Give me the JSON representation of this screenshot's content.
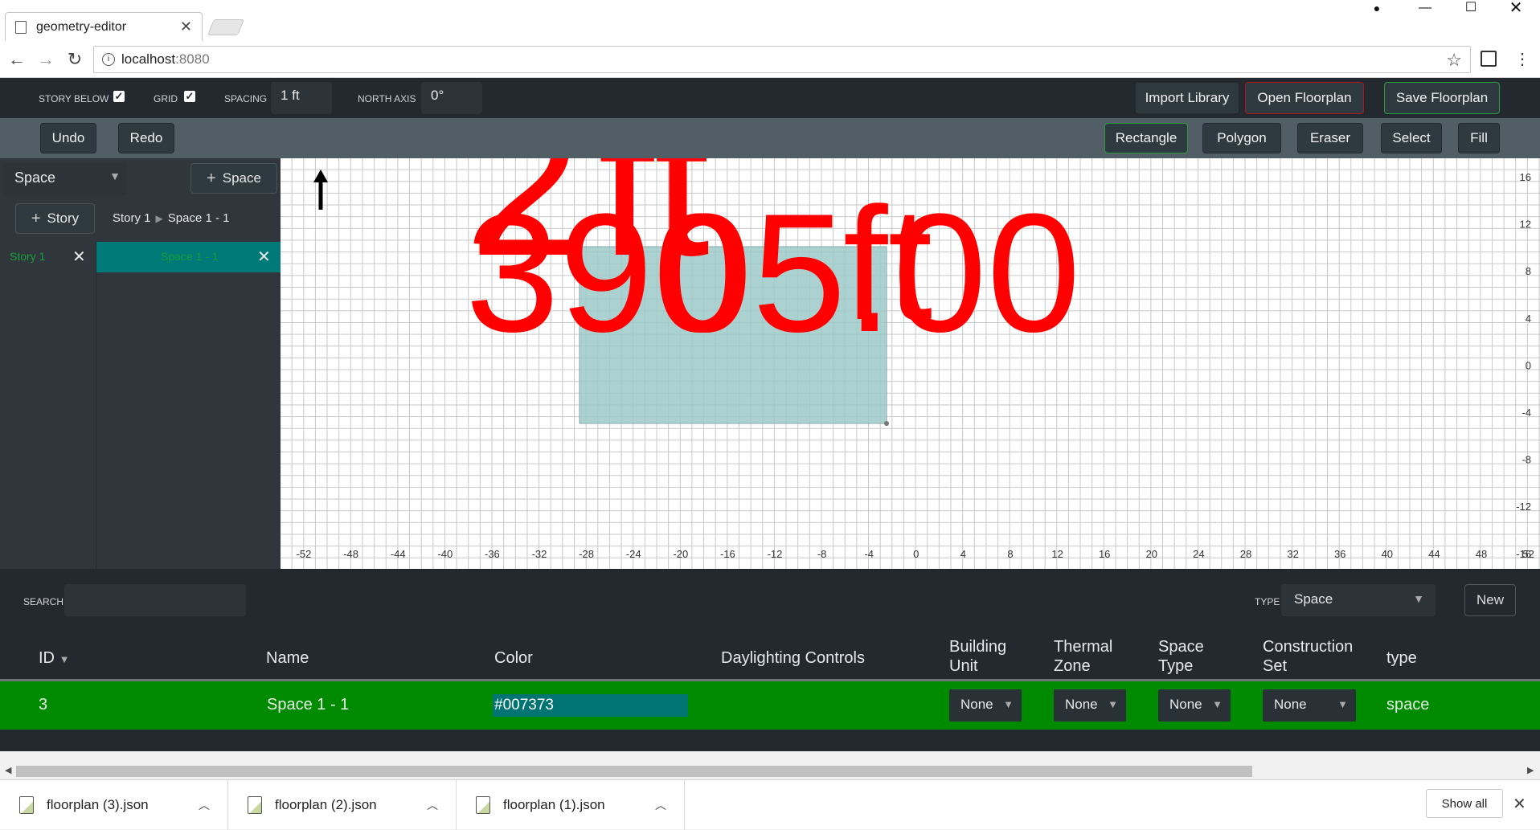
{
  "browser": {
    "tab_title": "geometry-editor",
    "url_host": "localhost",
    "url_port": ":8080"
  },
  "toolbar": {
    "story_below_label": "STORY BELOW",
    "story_below_checked": true,
    "grid_label": "GRID",
    "grid_checked": true,
    "spacing_label": "SPACING",
    "spacing_value": "1 ft",
    "north_axis_label": "NORTH AXIS",
    "north_axis_value": "0°",
    "import_library": "Import Library",
    "open_floorplan": "Open Floorplan",
    "save_floorplan": "Save Floorplan"
  },
  "tools": {
    "undo": "Undo",
    "redo": "Redo",
    "rectangle": "Rectangle",
    "polygon": "Polygon",
    "eraser": "Eraser",
    "select": "Select",
    "fill": "Fill",
    "active_tool": "Rectangle"
  },
  "left_panel": {
    "mode_select": "Space",
    "add_space": "Space",
    "add_story": "Story",
    "breadcrumb_story": "Story 1",
    "breadcrumb_space": "Space 1 - 1",
    "stories": [
      {
        "name": "Story 1"
      }
    ],
    "spaces": [
      {
        "name": "Space 1 - 1"
      }
    ]
  },
  "canvas": {
    "x_ticks": [
      "-52",
      "-48",
      "-44",
      "-40",
      "-36",
      "-32",
      "-28",
      "-24",
      "-20",
      "-16",
      "-12",
      "-8",
      "-4",
      "0",
      "4",
      "8",
      "12",
      "16",
      "20",
      "24",
      "28",
      "32",
      "36",
      "40",
      "44",
      "48",
      "52"
    ],
    "y_ticks": [
      "16",
      "12",
      "8",
      "4",
      "0",
      "-4",
      "-8",
      "-12",
      "-16"
    ],
    "overlay_text_1": "390",
    "overlay_text_2": "05.00",
    "overlay_text_3": "ft",
    "overlay_text_4": "2",
    "space_fill": "#9ec9c9",
    "overlay_color": "#ff0000"
  },
  "bottom": {
    "search_label": "SEARCH",
    "search_value": "",
    "type_label": "TYPE",
    "type_value": "Space",
    "new_button": "New",
    "columns": {
      "id": "ID",
      "name": "Name",
      "color": "Color",
      "daylighting": "Daylighting Controls",
      "building_unit_1": "Building",
      "building_unit_2": "Unit",
      "thermal_zone_1": "Thermal",
      "thermal_zone_2": "Zone",
      "space_type_1": "Space",
      "space_type_2": "Type",
      "construction_set_1": "Construction",
      "construction_set_2": "Set",
      "type": "type"
    },
    "rows": [
      {
        "id": "3",
        "name": "Space 1 - 1",
        "color": "#007373",
        "building_unit": "None",
        "thermal_zone": "None",
        "space_type": "None",
        "construction_set": "None",
        "type": "space"
      }
    ]
  },
  "downloads": {
    "files": [
      "floorplan (3).json",
      "floorplan (2).json",
      "floorplan (1).json"
    ],
    "show_all": "Show all"
  }
}
